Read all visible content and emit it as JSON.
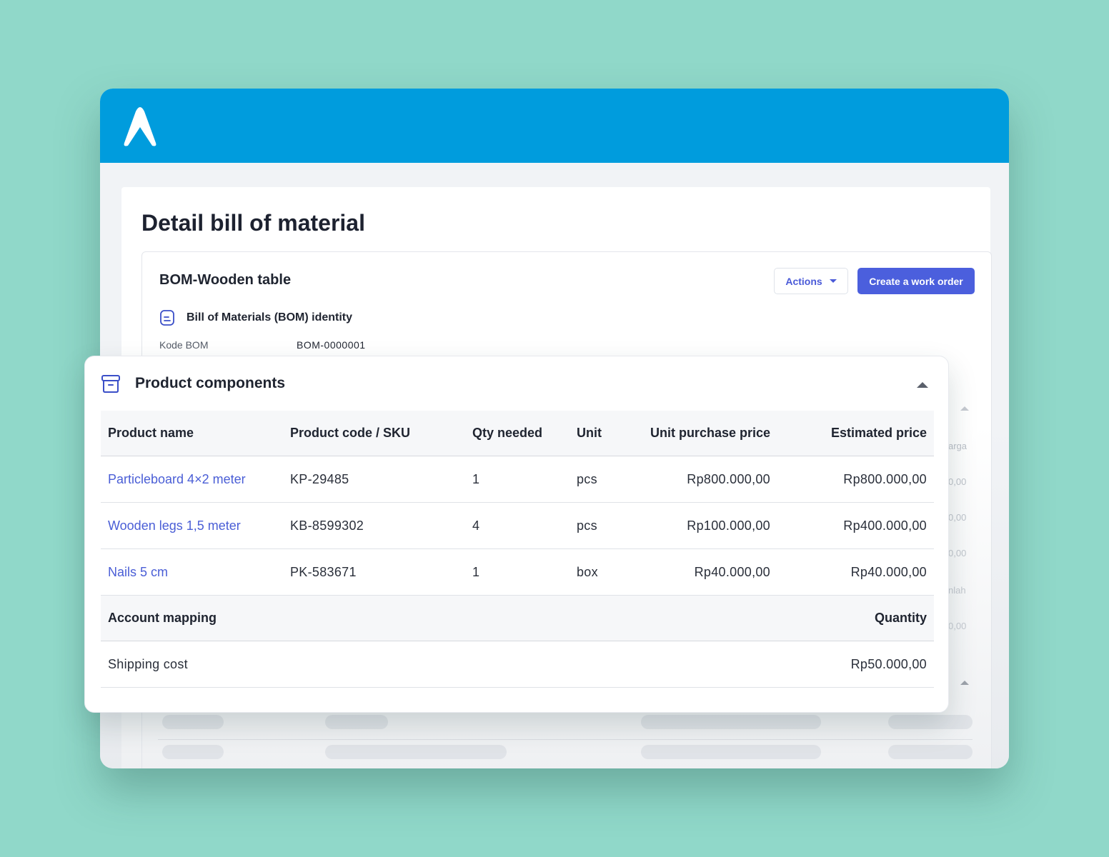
{
  "page": {
    "title": "Detail bill of material"
  },
  "bom": {
    "name": "BOM-Wooden table",
    "actions_label": "Actions",
    "create_label": "Create a work order",
    "identity_label": "Bill of Materials (BOM) identity",
    "kode_label": "Kode BOM",
    "kode_value": "BOM-0000001"
  },
  "components": {
    "title": "Product components",
    "columns": {
      "name": "Product name",
      "code": "Product code / SKU",
      "qty": "Qty needed",
      "unit": "Unit",
      "unit_price": "Unit purchase price",
      "estimated": "Estimated price"
    },
    "rows": [
      {
        "name": "Particleboard 4×2 meter",
        "code": "KP-29485",
        "qty": "1",
        "unit": "pcs",
        "unit_price": "Rp800.000,00",
        "estimated": "Rp800.000,00"
      },
      {
        "name": "Wooden legs 1,5 meter",
        "code": "KB-8599302",
        "qty": "4",
        "unit": "pcs",
        "unit_price": "Rp100.000,00",
        "estimated": "Rp400.000,00"
      },
      {
        "name": "Nails 5 cm",
        "code": "PK-583671",
        "qty": "1",
        "unit": "box",
        "unit_price": "Rp40.000,00",
        "estimated": "Rp40.000,00"
      }
    ],
    "account_mapping": {
      "label": "Account mapping",
      "quantity_label": "Quantity",
      "rows": [
        {
          "name": "Shipping cost",
          "amount": "Rp50.000,00"
        }
      ]
    }
  },
  "background_table": {
    "col_fragments": [
      "arga",
      "0,00",
      "0,00",
      "0,00",
      "nlah",
      "0,00"
    ]
  },
  "colors": {
    "background": "#90d8c9",
    "header": "#009cdd",
    "primary": "#4b5fdd",
    "link": "#4a5ed6"
  }
}
